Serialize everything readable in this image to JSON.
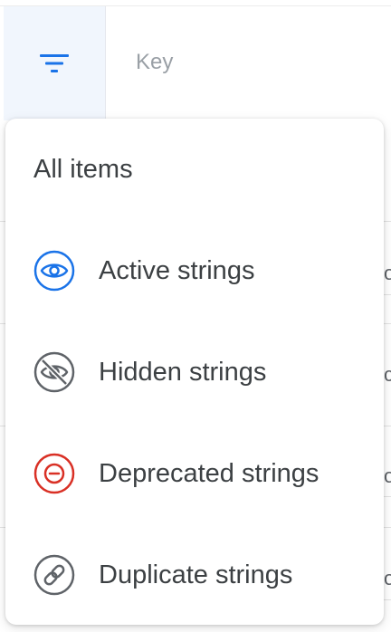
{
  "header": {
    "key_label": "Key",
    "filter_icon": "filter-list-icon",
    "filter_icon_color": "#1a73e8"
  },
  "background": {
    "fragments": [
      "o",
      "c",
      "o",
      "o"
    ]
  },
  "menu": {
    "items": [
      {
        "label": "All items",
        "icon": null
      },
      {
        "label": "Active strings",
        "icon": "eye-icon",
        "color": "#1a73e8"
      },
      {
        "label": "Hidden strings",
        "icon": "eye-off-icon",
        "color": "#5f6368"
      },
      {
        "label": "Deprecated strings",
        "icon": "minus-circle-icon",
        "color": "#d93025"
      },
      {
        "label": "Duplicate strings",
        "icon": "link-circle-icon",
        "color": "#5f6368"
      }
    ]
  }
}
